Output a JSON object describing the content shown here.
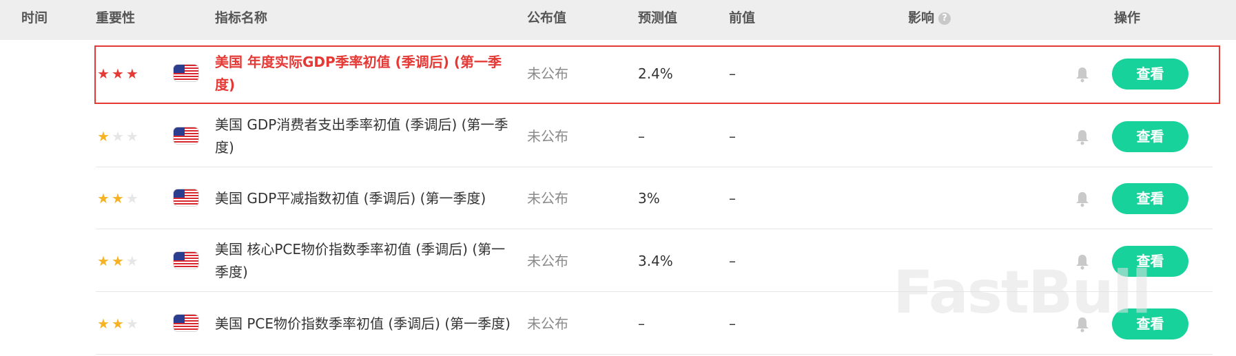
{
  "header": {
    "time": "时间",
    "importance": "重要性",
    "indicator": "指标名称",
    "actual": "公布值",
    "forecast": "预测值",
    "previous": "前值",
    "impact": "影响",
    "impact_help": "?",
    "action": "操作"
  },
  "rows": [
    {
      "stars": 3,
      "name": "美国 年度实际GDP季率初值 (季调后) (第一季度)",
      "actual": "未公布",
      "forecast": "2.4%",
      "previous": "–",
      "button": "查看",
      "highlighted": true
    },
    {
      "stars": 1,
      "name": "美国 GDP消费者支出季率初值 (季调后) (第一季度)",
      "actual": "未公布",
      "forecast": "–",
      "previous": "–",
      "button": "查看"
    },
    {
      "stars": 2,
      "name": "美国 GDP平减指数初值 (季调后) (第一季度)",
      "actual": "未公布",
      "forecast": "3%",
      "previous": "–",
      "button": "查看"
    },
    {
      "stars": 2,
      "name": "美国 核心PCE物价指数季率初值 (季调后) (第一季度)",
      "actual": "未公布",
      "forecast": "3.4%",
      "previous": "–",
      "button": "查看"
    },
    {
      "stars": 2,
      "name": "美国 PCE物价指数季率初值 (季调后) (第一季度)",
      "actual": "未公布",
      "forecast": "–",
      "previous": "–",
      "button": "查看"
    }
  ],
  "icons": {
    "flag": "us-flag-icon",
    "bell": "bell-icon",
    "star": "star-icon"
  },
  "colors": {
    "accent": "#17d39b",
    "highlight": "#e53935",
    "star": "#f5b323"
  },
  "watermark": "FastBull"
}
